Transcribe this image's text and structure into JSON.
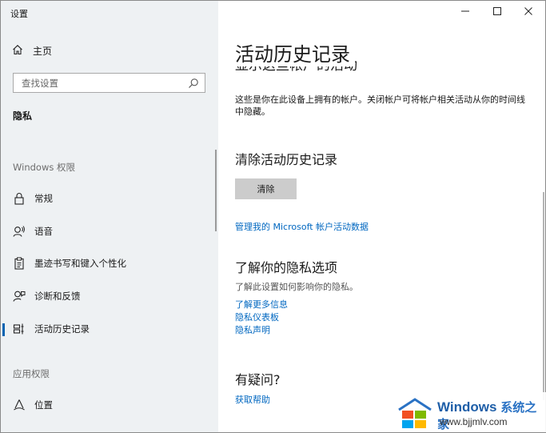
{
  "window": {
    "title": "设置"
  },
  "sidebar": {
    "home_label": "主页",
    "search_placeholder": "查找设置",
    "current_section": "隐私",
    "group_windows": "Windows 权限",
    "group_app": "应用权限",
    "items": [
      {
        "label": "常规",
        "icon": "lock-icon"
      },
      {
        "label": "语音",
        "icon": "speech-icon"
      },
      {
        "label": "墨迹书写和键入个性化",
        "icon": "clipboard-icon"
      },
      {
        "label": "诊断和反馈",
        "icon": "feedback-icon"
      },
      {
        "label": "活动历史记录",
        "icon": "timeline-icon",
        "active": true
      },
      {
        "label": "位置",
        "icon": "location-icon"
      }
    ]
  },
  "content": {
    "page_title": "活动历史记录",
    "cut_heading": "显示这些帐户的活动",
    "description": "这些是你在此设备上拥有的帐户。关闭帐户可将帐户相关活动从你的时间线中隐藏。",
    "clear_heading": "清除活动历史记录",
    "clear_button": "清除",
    "manage_link": "管理我的 Microsoft 帐户活动数据",
    "privacy_heading": "了解你的隐私选项",
    "privacy_desc": "了解此设置如何影响你的隐私。",
    "privacy_links": [
      "了解更多信息",
      "隐私仪表板",
      "隐私声明"
    ],
    "question_heading": "有疑问?",
    "help_link": "获取帮助"
  },
  "watermark": {
    "brand": "Windows",
    "brand_cn": "系统之家",
    "url": "www.bjjmlv.com"
  },
  "colors": {
    "accent": "#0063b1",
    "link": "#0067c0",
    "sidebar_bg": "#eef1f3",
    "button_bg": "#cccccc"
  }
}
